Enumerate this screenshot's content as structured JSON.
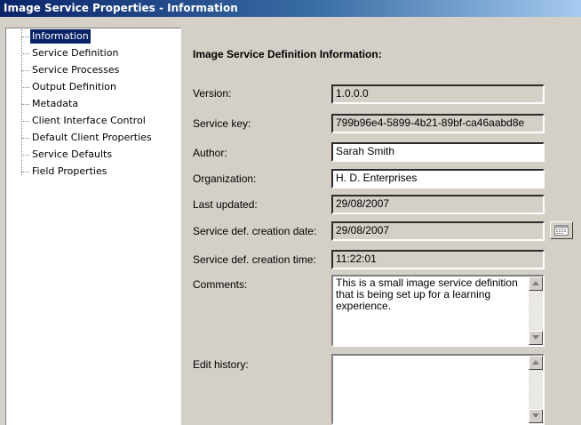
{
  "window": {
    "title": "Image Service Properties - Information"
  },
  "tree": {
    "items": [
      {
        "label": "Information",
        "selected": true
      },
      {
        "label": "Service Definition"
      },
      {
        "label": "Service Processes"
      },
      {
        "label": "Output Definition"
      },
      {
        "label": "Metadata"
      },
      {
        "label": "Client Interface Control"
      },
      {
        "label": "Default Client Properties"
      },
      {
        "label": "Service Defaults"
      },
      {
        "label": "Field Properties"
      }
    ]
  },
  "form": {
    "heading": "Image Service Definition Information:",
    "version": {
      "label": "Version:",
      "value": "1.0.0.0"
    },
    "service_key": {
      "label": "Service key:",
      "value": "799b96e4-5899-4b21-89bf-ca46aabd8e"
    },
    "author": {
      "label": "Author:",
      "value": "Sarah Smith"
    },
    "organization": {
      "label": "Organization:",
      "value": "H. D. Enterprises"
    },
    "last_updated": {
      "label": "Last updated:",
      "value": "29/08/2007"
    },
    "creation_date": {
      "label": "Service def. creation date:",
      "value": "29/08/2007"
    },
    "creation_time": {
      "label": "Service def. creation time:",
      "value": "11:22:01"
    },
    "comments": {
      "label": "Comments:",
      "value": "This is a small image service definition that is being set up for a learning experience."
    },
    "edit_history": {
      "label": "Edit history:",
      "value": ""
    }
  },
  "icons": {
    "calendar": "calendar-icon",
    "scroll_up": "scroll-up-arrow-icon",
    "scroll_down": "scroll-down-arrow-icon"
  },
  "colors": {
    "titlebar": "#0a246a",
    "face": "#d4d0c8",
    "selection": "#0a246a"
  }
}
